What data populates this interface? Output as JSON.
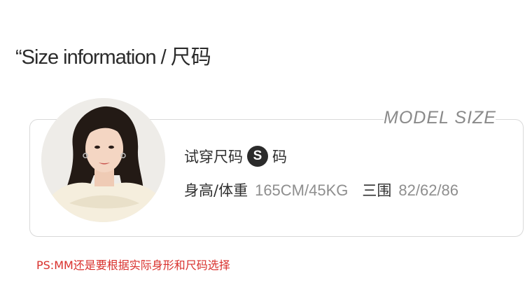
{
  "section": {
    "title_en": "“Size information",
    "title_sep": " / ",
    "title_cn": "尺码"
  },
  "card": {
    "model_size_label": "MODEL SIZE",
    "try_on_label": "试穿尺码",
    "size_badge": "S",
    "size_suffix": "码",
    "height_weight_label": "身高/体重",
    "height_weight_value": "165CM/45KG",
    "measurements_label": "三围",
    "measurements_value": "82/62/86"
  },
  "note": "PS:MM还是要根据实际身形和尺码选择",
  "colors": {
    "note_red": "#d9302c",
    "badge_dark": "#2b2b2b",
    "value_gray": "#8e8e8e"
  }
}
